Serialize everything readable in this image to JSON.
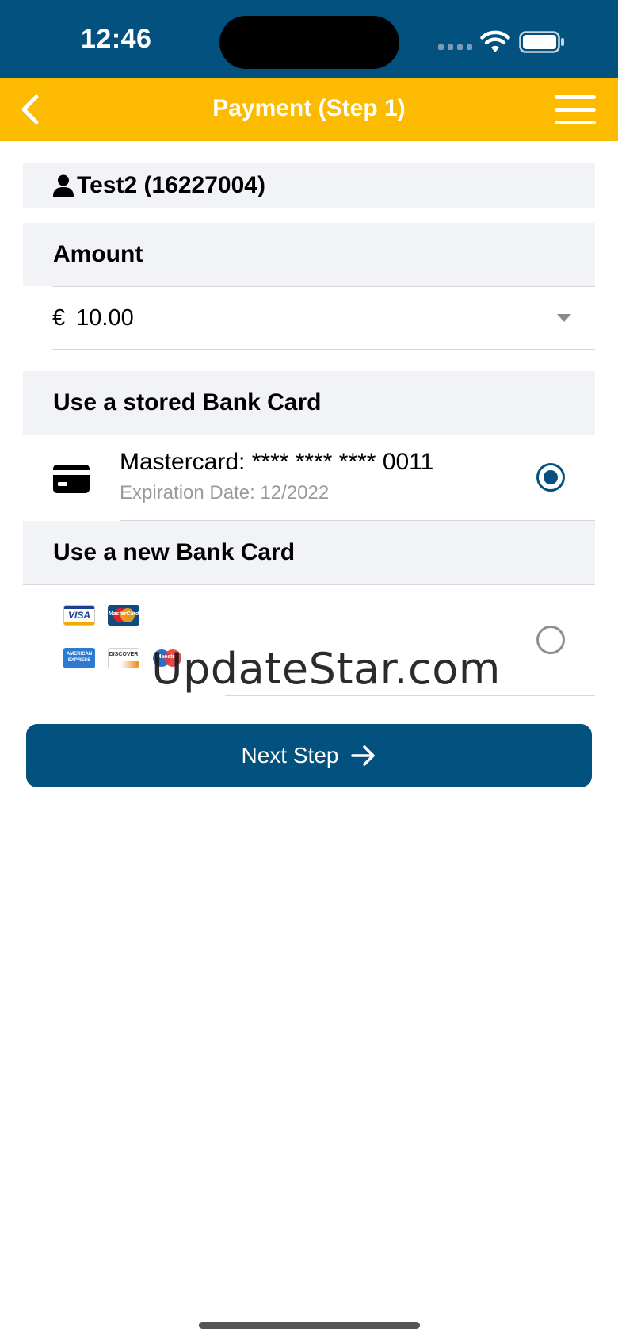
{
  "status_bar": {
    "time": "12:46",
    "background_color": "#02517f",
    "icons": [
      "cellular-signal-icon",
      "wifi-icon",
      "battery-icon"
    ]
  },
  "nav_bar": {
    "title": "Payment (Step 1)",
    "background_color": "#fcba00",
    "back_icon": "chevron-left-icon",
    "menu_icon": "hamburger-menu-icon"
  },
  "user": {
    "icon": "person-icon",
    "name": "Test2 (16227004)"
  },
  "amount_section": {
    "header": "Amount",
    "currency_symbol": "€",
    "value": "10.00"
  },
  "stored_card_section": {
    "header": "Use a stored Bank Card",
    "card": {
      "icon": "credit-card-icon",
      "title": "Mastercard: **** **** **** 0011",
      "expiration": "Expiration Date: 12/2022",
      "selected": true
    }
  },
  "new_card_section": {
    "header": "Use a new Bank Card",
    "brands": [
      {
        "name": "visa-logo",
        "label": "VISA"
      },
      {
        "name": "mastercard-logo",
        "label": "MasterCard"
      },
      {
        "name": "amex-logo",
        "label": "AMERICAN EXPRESS"
      },
      {
        "name": "discover-logo",
        "label": "DISCOVER"
      },
      {
        "name": "maestro-logo",
        "label": "Maestro"
      }
    ],
    "selected": false
  },
  "watermark": "UpdateStar.com",
  "next_button": {
    "label": "Next Step",
    "icon": "arrow-right-icon",
    "color": "#02517f"
  }
}
